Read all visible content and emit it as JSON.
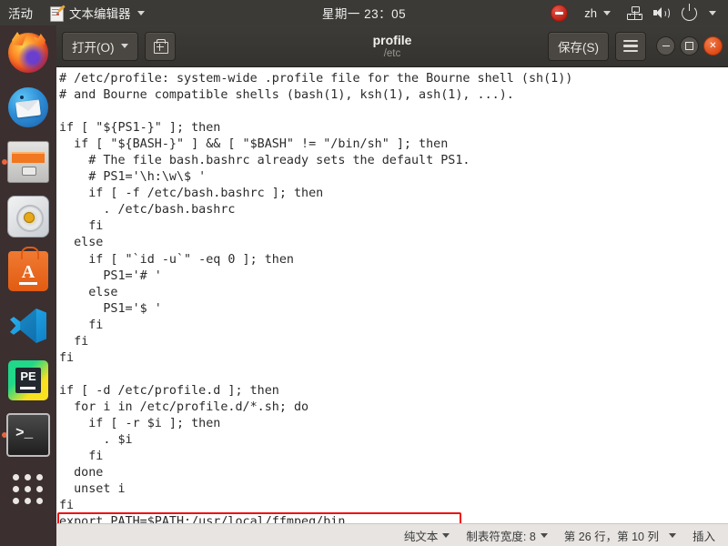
{
  "top_panel": {
    "activities": "活动",
    "app_name": "文本编辑器",
    "app_icon": "text-editor-icon",
    "clock": "星期一 23：05",
    "dnd_icon": "do-not-disturb-icon",
    "language": "zh",
    "network_icon": "wired-network-icon",
    "volume_icon": "volume-icon",
    "power_icon": "power-icon"
  },
  "dock": {
    "items": [
      {
        "name": "firefox",
        "label": "Firefox",
        "running": false
      },
      {
        "name": "thunderbird",
        "label": "Thunderbird",
        "running": false
      },
      {
        "name": "files",
        "label": "文件",
        "running": true
      },
      {
        "name": "rhythmbox",
        "label": "Rhythmbox",
        "running": false
      },
      {
        "name": "ubuntu-software",
        "label": "Ubuntu Software",
        "running": false
      },
      {
        "name": "vscode",
        "label": "Visual Studio Code",
        "running": false
      },
      {
        "name": "pycharm-edu",
        "label": "PyCharm Edu",
        "running": false
      },
      {
        "name": "terminal",
        "label": "终端",
        "running": true
      },
      {
        "name": "show-applications",
        "label": "显示应用程序",
        "running": false
      }
    ],
    "pycharm_label": "PE",
    "terminal_prompt": ">_",
    "software_letter": "A"
  },
  "headerbar": {
    "open_label": "打开(O)",
    "new_doc_icon": "save-as-document-icon",
    "title": "profile",
    "subtitle": "/etc",
    "save_label": "保存(S)",
    "menu_icon": "hamburger-menu-icon",
    "window_controls": {
      "minimize": "minimize-icon",
      "maximize": "maximize-icon",
      "close": "✕"
    }
  },
  "editor": {
    "content": "# /etc/profile: system-wide .profile file for the Bourne shell (sh(1))\n# and Bourne compatible shells (bash(1), ksh(1), ash(1), ...).\n\nif [ \"${PS1-}\" ]; then\n  if [ \"${BASH-}\" ] && [ \"$BASH\" != \"/bin/sh\" ]; then\n    # The file bash.bashrc already sets the default PS1.\n    # PS1='\\h:\\w\\$ '\n    if [ -f /etc/bash.bashrc ]; then\n      . /etc/bash.bashrc\n    fi\n  else\n    if [ \"`id -u`\" -eq 0 ]; then\n      PS1='# '\n    else\n      PS1='$ '\n    fi\n  fi\nfi\n\nif [ -d /etc/profile.d ]; then\n  for i in /etc/profile.d/*.sh; do\n    if [ -r $i ]; then\n      . $i\n    fi\n  done\n  unset i\nfi\nexport PATH=$PATH:/usr/local/ffmpeg/bin",
    "highlighted_line": "export PATH=$PATH:/usr/local/ffmpeg/bin",
    "annotation_color": "#ee1111"
  },
  "statusbar": {
    "file_type": "纯文本",
    "tab_width": "制表符宽度: 8",
    "cursor_position": "第 26 行，第 10 列",
    "insert_mode": "插入"
  }
}
